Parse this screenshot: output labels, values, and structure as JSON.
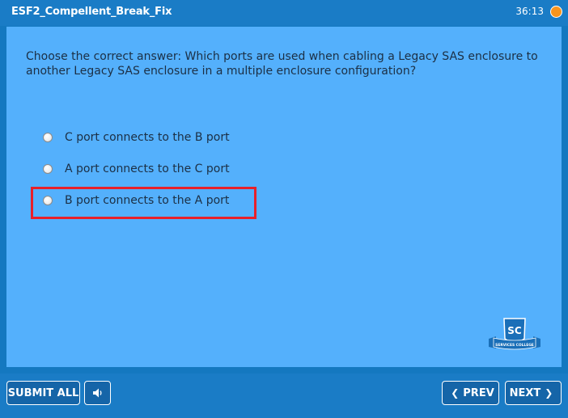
{
  "header": {
    "title": "ESF2_Compellent_Break_Fix",
    "timer": "36:13"
  },
  "question": {
    "text": "Choose the correct answer: Which ports are used when cabling a Legacy SAS enclosure to another Legacy SAS enclosure in a multiple enclosure configuration?",
    "options": [
      {
        "label": "C port connects to the B port"
      },
      {
        "label": "A port connects to the C port"
      },
      {
        "label": "B port connects to the A port"
      }
    ]
  },
  "logo": {
    "initials": "SC",
    "banner": "SERVICES COLLEGE"
  },
  "footer": {
    "submit_label": "SUBMIT ALL",
    "audio_icon": "speaker-icon",
    "prev_label": "PREV",
    "next_label": "NEXT"
  },
  "colors": {
    "header_bg": "#1a7cc6",
    "panel_bg": "#54b0fc",
    "highlight": "#e8202a",
    "timer_dot": "#f7941d"
  }
}
